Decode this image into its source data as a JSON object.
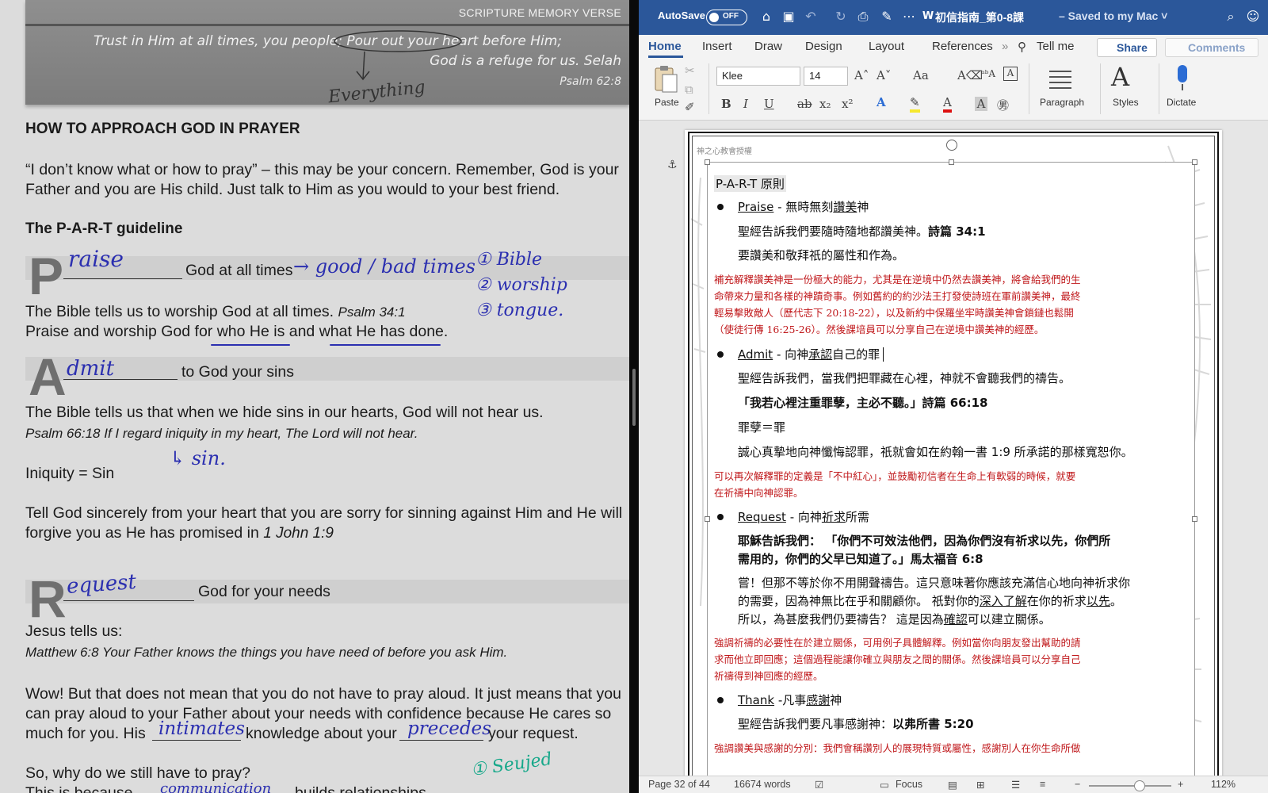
{
  "worksheet": {
    "verse_heading": "SCRIPTURE MEMORY VERSE",
    "verse_line_1": "Trust in Him at all times, you people; Pour out your heart before Him;",
    "verse_line_2": "God is a refuge for us. Selah",
    "verse_ref": "Psalm 62:8",
    "verse_note": "Everything",
    "section_title": "HOW TO APPROACH GOD IN PRAYER",
    "intro_line_1": "“I don’t know what or how to pray” – this may be your concern. Remember, God is your",
    "intro_line_2": "Father and you are His child. Just talk to Him as you would to your best friend.",
    "guideline_title": "The P-A-R-T guideline",
    "p_letter": "P",
    "p_answer": "raise",
    "p_suffix": "God at all times",
    "p_note": "→ good / bad times",
    "side_notes": [
      "① Bible",
      "② worship",
      "③ tongue."
    ],
    "p_body_1": "The Bible tells us to worship God at all times.",
    "p_body_1_ref": "Psalm 34:1",
    "p_body_2": "Praise and worship God for who He is and what He has done.",
    "a_letter": "A",
    "a_answer": "dmit",
    "a_suffix": "to God your sins",
    "a_body": "The Bible tells us that when we hide sins in our hearts, God will not hear us.",
    "a_verse": "Psalm 66:18  If I regard iniquity in my heart, The Lord will not hear.",
    "a_note": "↳ sin.",
    "iniquity": "Iniquity = Sin",
    "tell_1": "Tell God sincerely from your heart that you are sorry for sinning against Him and He will",
    "tell_2a": "forgive you as He has promised in ",
    "tell_2b": "1 John 1:9",
    "r_letter": "R",
    "r_answer": "equest",
    "r_suffix": "God for your needs",
    "jesus": "Jesus tells us:",
    "matthew": "Matthew 6:8 Your Father knows the things you have need of before you ask Him.",
    "wow_1": "Wow! But that does not mean that you do not have to pray aloud. It just means that you",
    "wow_2": "can pray aloud to your Father about your needs with confidence because He cares so",
    "wow_3a": "much for you. His",
    "wow_3_fill1": "intimates",
    "wow_3b": "knowledge about your",
    "wow_3_fill2": "precedes",
    "wow_3c": "your request.",
    "why": "So, why do we still have to pray?",
    "because": "This is because",
    "because_fill": "communication",
    "builds": "builds relationships",
    "green_note": "① Seujed"
  },
  "word": {
    "autosave_label": "AutoSave",
    "autosave_state": "OFF",
    "doc_title": "初信指南_第0-8課",
    "doc_saved": "– Saved to my Mac ˅",
    "tabs": [
      "Home",
      "Insert",
      "Draw",
      "Design",
      "Layout",
      "References"
    ],
    "tell_me": "Tell me",
    "share": "Share",
    "comments": "Comments",
    "font_name": "Klee",
    "font_size": "14",
    "paste_label": "Paste",
    "paragraph_label": "Paragraph",
    "styles_label": "Styles",
    "dictate_label": "Dictate",
    "page_header": "神之心教會授權",
    "doc": {
      "heading": "P-A-R-T 原則",
      "praise_word": "Praise",
      "praise_rest_a": " - 無時無刻",
      "praise_rest_u": "讚美",
      "praise_rest_b": "神",
      "praise_1a": "聖經告訴我們要隨時隨地都讚美神。",
      "praise_1b": "詩篇 34:1",
      "praise_2": "要讚美和敬拜祇的屬性和作為。",
      "praise_red": [
        "補充解釋讚美神是一份極大的能力，尤其是在逆境中仍然去讚美神，將會給我們的生",
        "命帶來力量和各樣的神蹟奇事。例如舊約的約沙法王打發使詩班在軍前讚美神，最終",
        "輕易擊敗敵人（歷代志下 20:18-22），以及新約中保羅坐牢時讚美神會鎖鏈也鬆開",
        "（使徒行傳 16:25-26）。然後課培員可以分享自己在逆境中讚美神的經歷。"
      ],
      "admit_word": "Admit",
      "admit_rest_a": " - 向神",
      "admit_rest_u": "承認",
      "admit_rest_b": "自己的罪",
      "admit_1": "聖經告訴我們，當我們把罪藏在心裡，神就不會聽我們的禱告。",
      "admit_2": "「我若心裡注重罪孽，主必不聽。」詩篇 66:18",
      "admit_3": "罪孽＝罪",
      "admit_4": "誠心真摯地向神懺悔認罪，祇就會如在約翰一書 1:9 所承諾的那樣寬恕你。",
      "admit_red": [
        "可以再次解釋罪的定義是「不中紅心」，並鼓勵初信者在生命上有軟弱的時候，就要",
        "在祈禱中向神認罪。"
      ],
      "request_word": "Request",
      "request_rest_a": " - 向神",
      "request_rest_u": "祈求",
      "request_rest_b": "所需",
      "request_1": "耶穌告訴我們： 「你們不可效法他們，因為你們沒有祈求以先，你們所",
      "request_2": "需用的，你們的父早已知道了。」馬太福音 6:8",
      "request_3": "嘗！但那不等於你不用開聲禱告。這只意味著你應該充滿信心地向神祈求你",
      "request_4a": "的需要，因為神無比在乎和關顧你。 祇對你的",
      "request_4u1": "深入了解",
      "request_4b": "在你的祈求",
      "request_4u2": "以先",
      "request_4c": "。",
      "request_5a": "所以，為甚麼我們仍要禱告？ 這是因為",
      "request_5u": "確認",
      "request_5b": "可以建立關係。",
      "request_red": [
        "強調祈禱的必要性在於建立關係，可用例子具體解釋。例如當你向朋友發出幫助的請",
        "求而他立即回應；這個過程能讓你確立與朋友之間的關係。然後課培員可以分享自己",
        "祈禱得到神回應的經歷。"
      ],
      "thank_word": "Thank",
      "thank_rest_a": " -凡事",
      "thank_rest_u": "感謝",
      "thank_rest_b": "神",
      "thank_1a": "聖經告訴我們要凡事感謝神：",
      "thank_1b": "以弗所書 5:20",
      "thank_red": "強調讚美與感謝的分別：我們會稱讚別人的展現特質或屬性，感謝別人在你生命所做"
    },
    "status": {
      "page": "Page 32 of 44",
      "words": "16674 words",
      "focus": "Focus",
      "zoom": "112%",
      "zoom_level": 0.62
    }
  }
}
